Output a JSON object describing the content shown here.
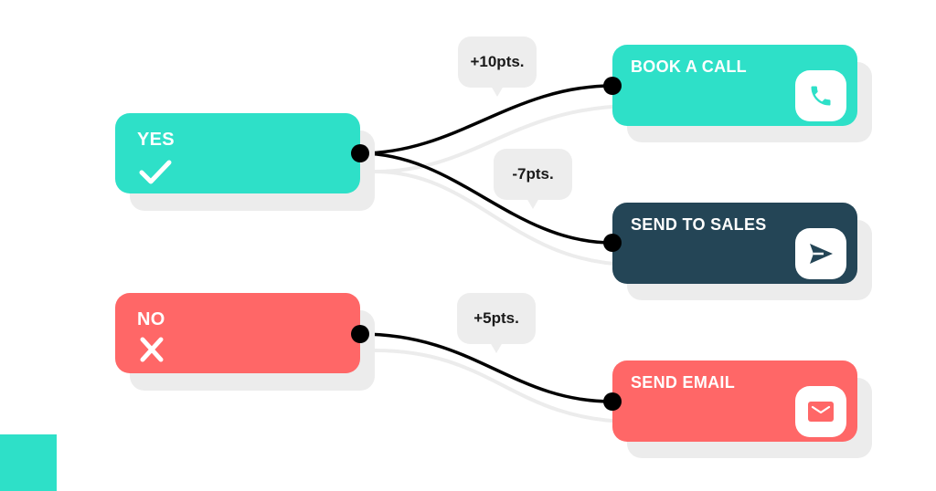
{
  "colors": {
    "teal": "#2ee0c8",
    "coral": "#ff6767",
    "navy": "#244556",
    "shadow": "#ececec",
    "bubble": "#ededed",
    "wire": "#000000"
  },
  "sources": [
    {
      "id": "yes",
      "label": "YES",
      "icon": "check-icon"
    },
    {
      "id": "no",
      "label": "NO",
      "icon": "x-icon"
    }
  ],
  "targets": [
    {
      "id": "book-call",
      "label": "BOOK A CALL",
      "icon": "phone-icon"
    },
    {
      "id": "send-sales",
      "label": "SEND TO SALES",
      "icon": "send-icon"
    },
    {
      "id": "send-email",
      "label": "SEND EMAIL",
      "icon": "mail-icon"
    }
  ],
  "connections": [
    {
      "from": "yes",
      "to": "book-call",
      "points": "+10pts."
    },
    {
      "from": "yes",
      "to": "send-sales",
      "points": "-7pts."
    },
    {
      "from": "no",
      "to": "send-email",
      "points": "+5pts."
    }
  ]
}
